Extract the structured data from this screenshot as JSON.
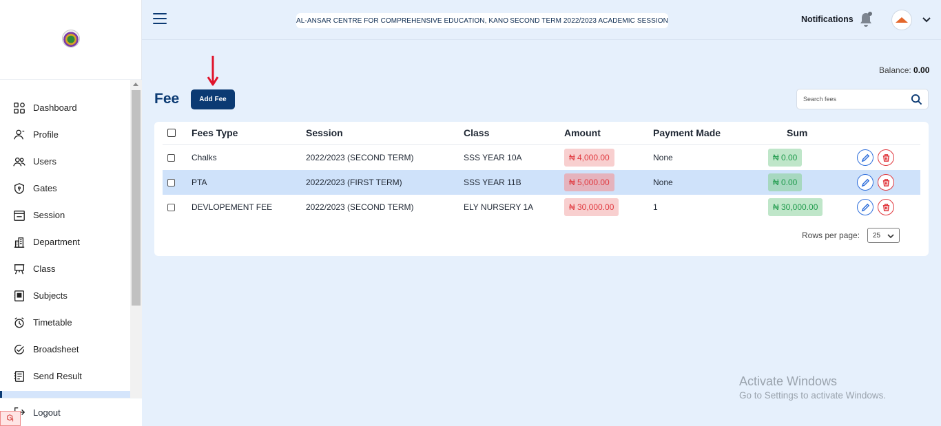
{
  "header": {
    "school_name": "AL-ANSAR CENTRE FOR COMPREHENSIVE EDUCATION, KANO",
    "session_info": "SECOND TERM 2022/2023 ACADEMIC SESSION",
    "notifications_label": "Notifications"
  },
  "sidebar": {
    "items": [
      {
        "label": "Dashboard",
        "icon": "dashboard-icon"
      },
      {
        "label": "Profile",
        "icon": "profile-icon"
      },
      {
        "label": "Users",
        "icon": "users-icon"
      },
      {
        "label": "Gates",
        "icon": "shield-icon"
      },
      {
        "label": "Session",
        "icon": "calendar-icon"
      },
      {
        "label": "Department",
        "icon": "building-icon"
      },
      {
        "label": "Class",
        "icon": "easel-icon"
      },
      {
        "label": "Subjects",
        "icon": "book-icon"
      },
      {
        "label": "Timetable",
        "icon": "alarm-clock-icon"
      },
      {
        "label": "Broadsheet",
        "icon": "check-circle-icon"
      },
      {
        "label": "Send Result",
        "icon": "document-icon"
      }
    ],
    "logout_label": "Logout"
  },
  "balance": {
    "label": "Balance:",
    "value": "0.00"
  },
  "page": {
    "title": "Fee",
    "add_button": "Add Fee",
    "search_placeholder": "Search fees"
  },
  "table": {
    "columns": [
      "Fees Type",
      "Session",
      "Class",
      "Amount",
      "Payment Made",
      "Sum"
    ],
    "rows": [
      {
        "fees_type": "Chalks",
        "session": "2022/2023 (SECOND TERM)",
        "class": "SSS YEAR 10A",
        "amount": "₦ 4,000.00",
        "payment_made": "None",
        "sum": "₦ 0.00",
        "highlighted": false
      },
      {
        "fees_type": "PTA",
        "session": "2022/2023 (FIRST TERM)",
        "class": "SSS YEAR 11B",
        "amount": "₦ 5,000.00",
        "payment_made": "None",
        "sum": "₦ 0.00",
        "highlighted": true
      },
      {
        "fees_type": "DEVLOPEMENT FEE",
        "session": "2022/2023 (SECOND TERM)",
        "class": "ELY NURSERY 1A",
        "amount": "₦ 30,000.00",
        "payment_made": "1",
        "sum": "₦ 30,000.00",
        "highlighted": false
      }
    ],
    "rows_per_page_label": "Rows per page:",
    "rows_per_page_value": "25"
  },
  "watermark": {
    "line1": "Activate Windows",
    "line2": "Go to Settings to activate Windows."
  },
  "colors": {
    "primary": "#0b3a73",
    "amount_red": "#e0383e",
    "sum_green": "#1e9a4b",
    "highlight_row": "#cfe2fa",
    "annotation_arrow": "#e0142b"
  }
}
